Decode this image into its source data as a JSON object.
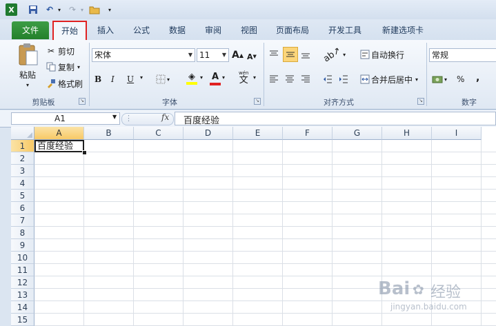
{
  "qat": {
    "undo_glyph": "↶",
    "redo_glyph": "↷",
    "dropdown_glyph": "▾"
  },
  "tabs": [
    {
      "label": "文件"
    },
    {
      "label": "开始"
    },
    {
      "label": "插入"
    },
    {
      "label": "公式"
    },
    {
      "label": "数据"
    },
    {
      "label": "审阅"
    },
    {
      "label": "视图"
    },
    {
      "label": "页面布局"
    },
    {
      "label": "开发工具"
    },
    {
      "label": "新建选项卡"
    }
  ],
  "clipboard": {
    "paste": "粘贴",
    "cut": "剪切",
    "copy": "复制",
    "format_painter": "格式刷",
    "group": "剪贴板"
  },
  "font": {
    "name": "宋体",
    "size": "11",
    "bold": "B",
    "italic": "I",
    "underline": "U",
    "group": "字体",
    "grow": "A",
    "shrink": "A",
    "fill_letter": "",
    "color_letter": "A",
    "phonetic": "wén"
  },
  "alignment": {
    "wrap": "自动换行",
    "merge": "合并后居中",
    "group": "对齐方式"
  },
  "number": {
    "format": "常规",
    "percent": "%",
    "comma": ",",
    "group": "数字"
  },
  "formula_bar": {
    "name_box": "A1",
    "fx": "fx",
    "content": "百度经验"
  },
  "grid": {
    "columns": [
      "A",
      "B",
      "C",
      "D",
      "E",
      "F",
      "G",
      "H",
      "I"
    ],
    "rows": [
      "1",
      "2",
      "3",
      "4",
      "5",
      "6",
      "7",
      "8",
      "9",
      "10",
      "11",
      "12",
      "13",
      "14",
      "15"
    ],
    "a1_value": "百度经验"
  },
  "watermark": {
    "brand": "Bai",
    "brand_cn": "经验",
    "url": "jingyan.baidu.com"
  },
  "colors": {
    "accent_file": "#2a8a33",
    "select_header": "#f8c966",
    "highlight_box": "#e02121"
  }
}
